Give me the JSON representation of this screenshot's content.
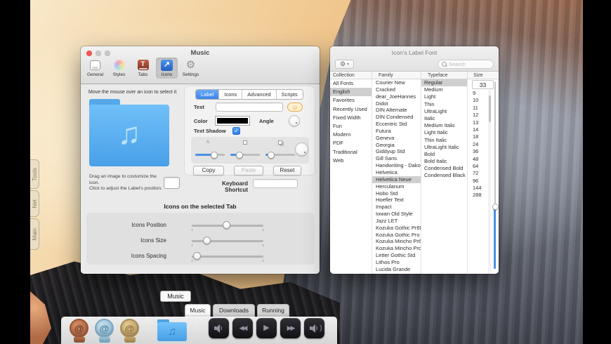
{
  "desktop": {
    "edge_tabs": [
      "Tools",
      "Net",
      "Main"
    ]
  },
  "glyphs": {
    "gear": "⚙",
    "caret_down": "▾",
    "smiley": "☺",
    "check": "✓",
    "music_note": "♫",
    "play": "▶",
    "rewind": "◀◀",
    "fast_forward": "▶▶",
    "arrow_up_right": "↗",
    "tabs_t": "T",
    "shadow_a": "A",
    "at_sign": "@"
  },
  "music_window": {
    "title": "Music",
    "toolbar_items": [
      "General",
      "Styles",
      "Tabs",
      "Icons",
      "Settings"
    ],
    "toolbar_selected": "Icons",
    "hint": "Move the mouse over an icon to select it",
    "drag_hint_line1": "Drag an image to costumize the icon.",
    "drag_hint_line2": "Click to adjust the Label's position.",
    "label_tabs": [
      "Label",
      "Icons",
      "Advanced",
      "Scripts"
    ],
    "label_tabs_selected": "Label",
    "text_label": "Text",
    "text_value": "",
    "color_label": "Color",
    "color_value": "#000000",
    "angle_label": "Angle",
    "shadow_label": "Text Shadow",
    "shadow_checked": true,
    "shadow_sliders": [
      {
        "icon": "letter-a",
        "value": 65
      },
      {
        "icon": "shadow-box",
        "value": 32
      },
      {
        "icon": "shadow-box-offset",
        "value": 20
      }
    ],
    "copy_label": "Copy",
    "paste_label": "Paste",
    "reset_label": "Reset",
    "keyboard_shortcut_label": "Keyboard Shortcut",
    "keyboard_shortcut_value": "",
    "section_title": "Icons on the selected Tab",
    "tab_sliders": [
      {
        "label": "Icons Position",
        "value": 49
      },
      {
        "label": "Icons Size",
        "value": 21
      },
      {
        "label": "Icons Spacing",
        "value": 7
      }
    ]
  },
  "font_window": {
    "title": "Icon's Label Font",
    "search_placeholder": "Search",
    "columns": [
      "Collection",
      "Family",
      "Typeface",
      "Size"
    ],
    "collections": [
      "All Fonts",
      "English",
      "Favorites",
      "Recently Used",
      "Fixed Width",
      "Fun",
      "Modern",
      "PDF",
      "Traditional",
      "Web"
    ],
    "collection_selected": "English",
    "families": [
      "Courier New",
      "Cracked",
      "dear_JoeHannes",
      "Didot",
      "DIN Alternate",
      "DIN Condensed",
      "Eccentric Std",
      "Futura",
      "Geneva",
      "Georgia",
      "Giddyup Std",
      "Gill Sans",
      "Handwriting - Dakota",
      "Helvetica",
      "Helvetica Neue",
      "Herculanum",
      "Hobo Std",
      "Hoefler Text",
      "Impact",
      "Iowan Old Style",
      "Jazz LET",
      "Kozuka Gothic Pr6N",
      "Kozuka Gothic Pro",
      "Kozuka Mincho Pr6N",
      "Kozuka Mincho Pro",
      "Letter Gothic Std",
      "Lithos Pro",
      "Lucida Grande"
    ],
    "family_selected": "Helvetica Neue",
    "typefaces": [
      "Regular",
      "Medium",
      "Light",
      "Thin",
      "UltraLight",
      "Italic",
      "Medium Italic",
      "Light Italic",
      "Thin Italic",
      "UltraLight Italic",
      "Bold",
      "Bold Italic",
      "Condensed Bold",
      "Condensed Black"
    ],
    "typeface_selected": "Regular",
    "size_value": "33",
    "sizes": [
      "9",
      "10",
      "11",
      "12",
      "13",
      "14",
      "18",
      "24",
      "36",
      "48",
      "64",
      "72",
      "96",
      "144",
      "288"
    ],
    "size_slider_pos": 67
  },
  "dock": {
    "tooltip": "Music",
    "tabs": [
      "Music",
      "Downloads",
      "Running"
    ],
    "tab_selected": "Music",
    "stamp_icons": [
      "at-stamp-copper",
      "at-stamp-blue",
      "at-stamp-gold"
    ],
    "folder_icon": "music-folder",
    "media_buttons": [
      "volume-down",
      "rewind",
      "play",
      "fast-forward",
      "volume-up"
    ]
  },
  "colors": {
    "accent_blue": "#3c85e9",
    "selection_gray": "#cfcfcf",
    "slider_blue": "#4a90e2"
  }
}
